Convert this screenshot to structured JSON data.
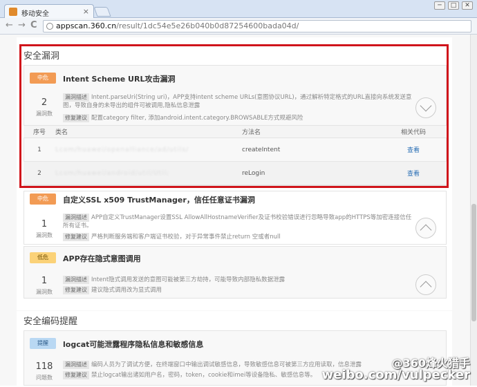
{
  "browser": {
    "tab_title": "移动安全",
    "tab_close": "×",
    "window_buttons": [
      "─",
      "□",
      "✕"
    ],
    "back": "←",
    "forward": "→",
    "reload": "C",
    "url_host": "appscan.360.cn",
    "url_path": "/result/1dc54e5e26b040b0d87254600bada04d/"
  },
  "section1": {
    "title": "安全漏洞",
    "items": [
      {
        "level": "中危",
        "title": "Intent Scheme URL攻击漏洞",
        "count": "2",
        "count_label": "漏洞数",
        "desc_tag": "漏洞描述",
        "desc": "Intent.parseUri(String uri)，APP支持intent scheme URLs(意图协议URL)，通过解析特定格式的URL直接向系统发送意图，导致自身的未导出的组件可被调用,隐私信息泄露",
        "fix_tag": "修复建议",
        "fix": "配置category filter, 添加android.intent.category.BROWSABLE方式规避风险",
        "expanded": true
      },
      {
        "level": "中危",
        "title": "自定义SSL x509 TrustManager，信任任意证书漏洞",
        "count": "1",
        "count_label": "漏洞数",
        "desc_tag": "漏洞描述",
        "desc": "APP自定义TrustManager设置SSL AllowAllHostnameVerifier及证书校验错误进行忽略导致app的HTTPS等加密连接信任所有证书。",
        "fix_tag": "修复建议",
        "fix": "严格判断服务端和客户端证书校验，对于异常事件禁止return 空或者null",
        "expanded": false
      },
      {
        "level": "低危",
        "title": "APP存在隐式意图调用",
        "count": "1",
        "count_label": "漏洞数",
        "desc_tag": "漏洞描述",
        "desc": "Intent隐式调用发送的意图可能被第三方劫持，可能导致内部隐私数据泄露",
        "fix_tag": "修复建议",
        "fix": "建议隐式调用改为显式调用",
        "expanded": false
      }
    ],
    "table": {
      "headers": [
        "序号",
        "类名",
        "方法名",
        "相关代码"
      ],
      "rows": [
        {
          "index": "1",
          "class": "Lcom/huawei/openalliance/ad/utils/",
          "method": "createIntent",
          "code": "查看"
        },
        {
          "index": "2",
          "class": "Lcom/huawei/android/util/Util;",
          "method": "reLogin",
          "code": "查看"
        }
      ]
    }
  },
  "section2": {
    "title": "安全编码提醒",
    "item": {
      "level": "提醒",
      "title": "logcat可能泄露程序隐私信息和敏感信息",
      "count": "118",
      "count_label": "问题数",
      "desc_tag": "漏洞描述",
      "desc": "编码人员为了调试方便，在终端窗口中输出调试敏感信息，导致敏感信息可被第三方应用读取，信息泄露",
      "fix_tag": "修复建议",
      "fix": "禁止logcat输出诸如用户名，密码，token，cookie和imei等设备隐私、敏感信息等。"
    }
  },
  "watermark": {
    "line1": "@360烽火猎手",
    "line2": "weibo.com/vulpecker"
  }
}
